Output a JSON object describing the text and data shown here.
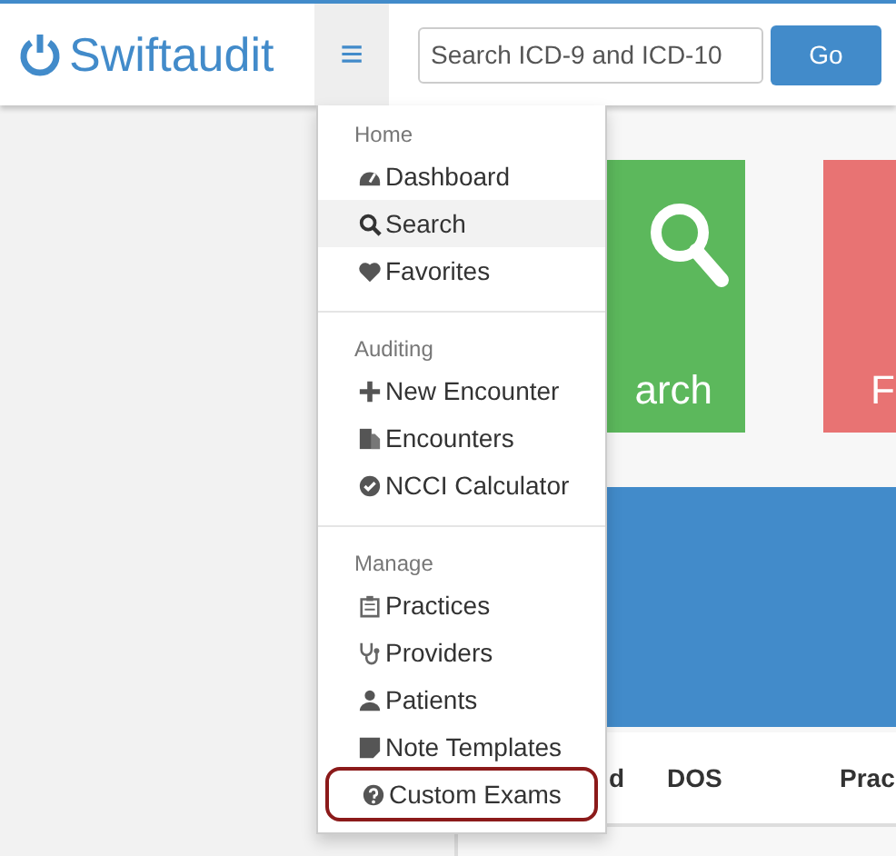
{
  "header": {
    "logo": "Swiftaudit",
    "menu_button": "≡",
    "search": {
      "placeholder": "Search ICD-9 and ICD-10"
    },
    "go_button": "Go"
  },
  "tiles": [
    {
      "label": "arch",
      "color": "#5cb85c"
    },
    {
      "label": "F",
      "color": "#e87373"
    }
  ],
  "table": {
    "columns": [
      "d",
      "DOS",
      "Prac"
    ]
  },
  "menu": {
    "sections": [
      {
        "heading": "Home",
        "items": [
          {
            "label": "Dashboard",
            "selected": false,
            "outlined": false
          },
          {
            "label": "Search",
            "selected": true,
            "outlined": false
          },
          {
            "label": "Favorites",
            "selected": false,
            "outlined": false
          }
        ]
      },
      {
        "heading": "Auditing",
        "items": [
          {
            "label": "New Encounter",
            "selected": false,
            "outlined": false
          },
          {
            "label": "Encounters",
            "selected": false,
            "outlined": false
          },
          {
            "label": "NCCI Calculator",
            "selected": false,
            "outlined": false
          }
        ]
      },
      {
        "heading": "Manage",
        "items": [
          {
            "label": "Practices",
            "selected": false,
            "outlined": false
          },
          {
            "label": "Providers",
            "selected": false,
            "outlined": false
          },
          {
            "label": "Patients",
            "selected": false,
            "outlined": false
          },
          {
            "label": "Note Templates",
            "selected": false,
            "outlined": false
          },
          {
            "label": "Custom Exams",
            "selected": false,
            "outlined": true
          }
        ]
      }
    ]
  }
}
